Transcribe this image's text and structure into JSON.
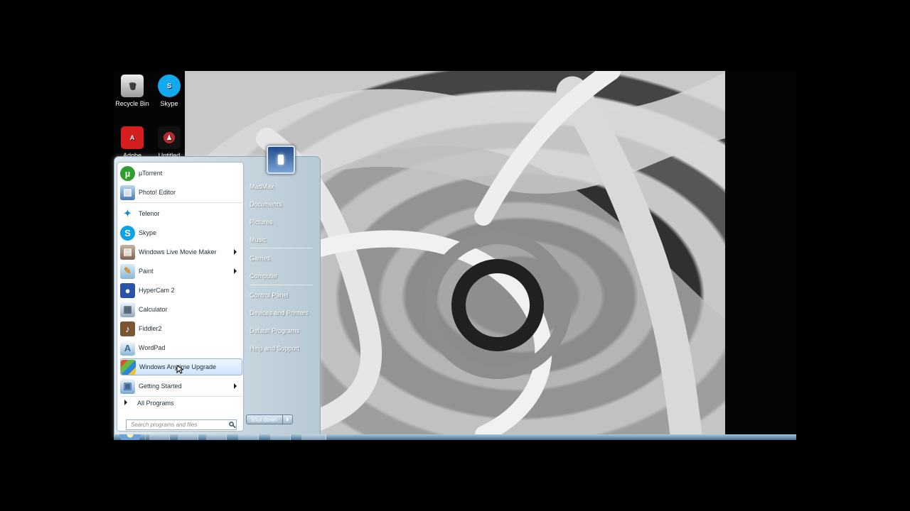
{
  "desktop": {
    "icons": [
      {
        "label": "Recycle Bin",
        "icon": "recycle-bin-icon"
      },
      {
        "label": "Skype",
        "icon": "skype-icon"
      },
      {
        "label": "Adobe",
        "icon": "adobe-reader-icon"
      },
      {
        "label": "Untitled",
        "icon": "untitled-app-icon"
      }
    ]
  },
  "start_menu": {
    "programs": [
      {
        "label": "µTorrent",
        "icon": "utorrent-icon",
        "color": "#2e9f2e"
      },
      {
        "label": "Photo! Editor",
        "icon": "photo-editor-icon",
        "color": "#4b78b8"
      },
      {
        "label": "Telenor",
        "icon": "telenor-icon",
        "color": "#1b86d0"
      },
      {
        "label": "Skype",
        "icon": "skype-icon",
        "color": "#0aa4e4"
      },
      {
        "label": "Windows Live Movie Maker",
        "icon": "movie-maker-icon",
        "color": "#7e6653"
      },
      {
        "label": "Paint",
        "icon": "paint-icon",
        "color": "#8ab5d8"
      },
      {
        "label": "HyperCam 2",
        "icon": "hypercam-icon",
        "color": "#2853a6"
      },
      {
        "label": "Calculator",
        "icon": "calculator-icon",
        "color": "#91a9bf"
      },
      {
        "label": "Fiddler2",
        "icon": "fiddler-icon",
        "color": "#7a5632"
      },
      {
        "label": "WordPad",
        "icon": "wordpad-icon",
        "color": "#8ab5d8"
      },
      {
        "label": "Windows Anytime Upgrade",
        "icon": "windows-anytime-upgrade-icon",
        "color": "#4d8fdc"
      },
      {
        "label": "Getting Started",
        "icon": "getting-started-icon",
        "color": "#78a9d8"
      }
    ],
    "all_programs": "All Programs",
    "search_placeholder": "Search programs and files",
    "places": [
      "MadMax",
      "Documents",
      "Pictures",
      "Music",
      "Games",
      "Computer",
      "Control Panel",
      "Devices and Printers",
      "Default Programs",
      "Help and Support"
    ],
    "shutdown": "Shut down"
  },
  "colors": {
    "selected": "#cfe5fb",
    "menu_right": "#b7c9d4",
    "taskbar": "#456b8c"
  }
}
